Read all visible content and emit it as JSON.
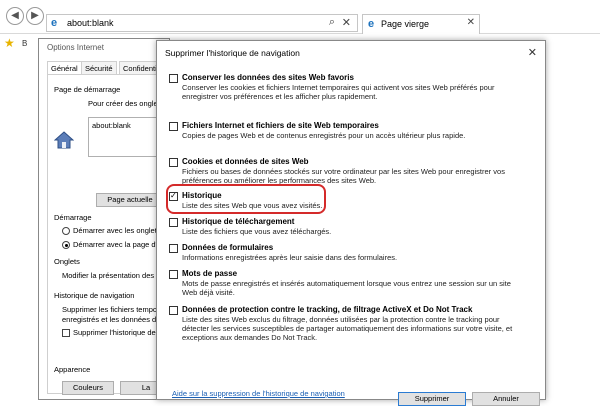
{
  "browser": {
    "url": "about:blank",
    "tab_title": "Page vierge",
    "favorites_partial": "B"
  },
  "internet_options": {
    "title": "Options Internet",
    "tabs": [
      "Général",
      "Sécurité",
      "Confidentiali"
    ],
    "home_group": "Page de démarrage",
    "home_desc": "Pour créer des onglet",
    "home_value": "about:blank",
    "current_page_btn": "Page actuelle",
    "startup_group": "Démarrage",
    "startup_opt1": "Démarrer avec les onglets",
    "startup_opt2": "Démarrer avec la page d'a",
    "tabs_group": "Onglets",
    "tabs_desc": "Modifier la présentation des pa",
    "history_group": "Historique de navigation",
    "history_desc1": "Supprimer les fichiers tempora",
    "history_desc2": "enregistrés et les données de fo",
    "delete_on_exit": "Supprimer l'historique de n",
    "appearance_group": "Apparence",
    "colors_btn": "Couleurs",
    "lang_btn_partial": "La"
  },
  "delete_dialog": {
    "title": "Supprimer l'historique de navigation",
    "close": "✕",
    "options": [
      {
        "name": "Conserver les données des sites Web favoris",
        "desc": "Conserver les cookies et fichiers Internet temporaires qui activent vos sites Web préférés pour enregistrer vos préférences et les afficher plus rapidement.",
        "checked": false
      },
      {
        "name": "Fichiers Internet et fichiers de site Web temporaires",
        "desc": "Copies de pages Web et de contenus enregistrés pour un accès ultérieur plus rapide.",
        "checked": false
      },
      {
        "name": "Cookies et données de sites Web",
        "desc": "Fichiers ou bases de données stockés sur votre ordinateur par les sites Web pour enregistrer vos préférences ou améliorer les performances des sites Web.",
        "checked": false
      },
      {
        "name": "Historique",
        "desc": "Liste des sites Web que vous avez visités.",
        "checked": true
      },
      {
        "name": "Historique de téléchargement",
        "desc": "Liste des fichiers que vous avez téléchargés.",
        "checked": false
      },
      {
        "name": "Données de formulaires",
        "desc": "Informations enregistrées après leur saisie dans des formulaires.",
        "checked": false
      },
      {
        "name": "Mots de passe",
        "desc": "Mots de passe enregistrés et insérés automatiquement lorsque vous entrez une session sur un site Web déjà visité.",
        "checked": false
      },
      {
        "name": "Données de protection contre le tracking, de filtrage ActiveX et Do Not Track",
        "desc": "Liste des sites Web exclus du filtrage, données utilisées par la protection contre le tracking pour détecter les services susceptibles de partager automatiquement des informations sur votre visite, et exceptions aux demandes Do Not Track.",
        "checked": false
      }
    ],
    "help_link": "Aide sur la suppression de l'historique de navigation",
    "delete_btn": "Supprimer",
    "cancel_btn": "Annuler",
    "highlight_color": "#d42a2a"
  }
}
